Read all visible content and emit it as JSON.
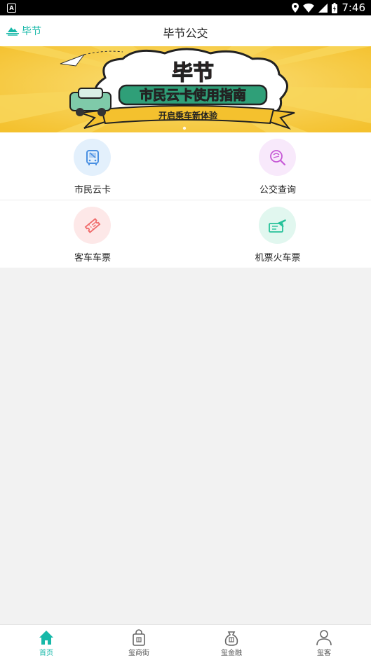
{
  "status": {
    "time": "7:46"
  },
  "header": {
    "location": "毕节",
    "title": "毕节公交"
  },
  "banner": {
    "title": "毕节",
    "subtitle": "市民云卡使用指南",
    "tagline": "开启乘车新体验"
  },
  "grid": [
    {
      "label": "市民云卡",
      "icon": "bus-icon",
      "color": "#4a90e2",
      "bg": "#e3f0fc"
    },
    {
      "label": "公交查询",
      "icon": "search-icon",
      "color": "#c659d6",
      "bg": "#f8e9fb"
    },
    {
      "label": "客车车票",
      "icon": "ticket-icon",
      "color": "#f06a6a",
      "bg": "#fde8e8"
    },
    {
      "label": "机票火车票",
      "icon": "plane-ticket-icon",
      "color": "#27c29a",
      "bg": "#e1f7ef"
    }
  ],
  "tabs": [
    {
      "label": "首页",
      "icon": "home-icon"
    },
    {
      "label": "玺商街",
      "icon": "shopping-bag-icon"
    },
    {
      "label": "玺金融",
      "icon": "money-bag-icon"
    },
    {
      "label": "玺客",
      "icon": "user-icon"
    }
  ],
  "colors": {
    "accent": "#16b8a8",
    "banner": "#f6c93a"
  }
}
